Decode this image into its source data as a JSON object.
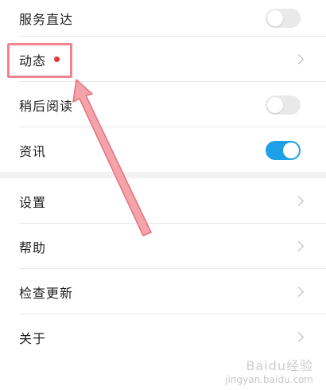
{
  "top_group": {
    "items": [
      {
        "label": "服务直达",
        "control": "toggle",
        "state": "off"
      },
      {
        "label": "动态",
        "control": "chevron",
        "badge": "red-dot"
      },
      {
        "label": "稍后阅读",
        "control": "toggle",
        "state": "off"
      },
      {
        "label": "资讯",
        "control": "toggle",
        "state": "on"
      }
    ]
  },
  "bottom_group": {
    "items": [
      {
        "label": "设置",
        "control": "chevron"
      },
      {
        "label": "帮助",
        "control": "chevron"
      },
      {
        "label": "检查更新",
        "control": "chevron"
      },
      {
        "label": "关于",
        "control": "chevron"
      }
    ]
  },
  "colors": {
    "toggle_on": "#1ea0e8",
    "toggle_off": "#e9e9e9",
    "badge_dot": "#e53935",
    "annotation": "#f0838f"
  },
  "watermark": {
    "main": "Baidu经验",
    "sub": "jingyan.baidu.com"
  }
}
